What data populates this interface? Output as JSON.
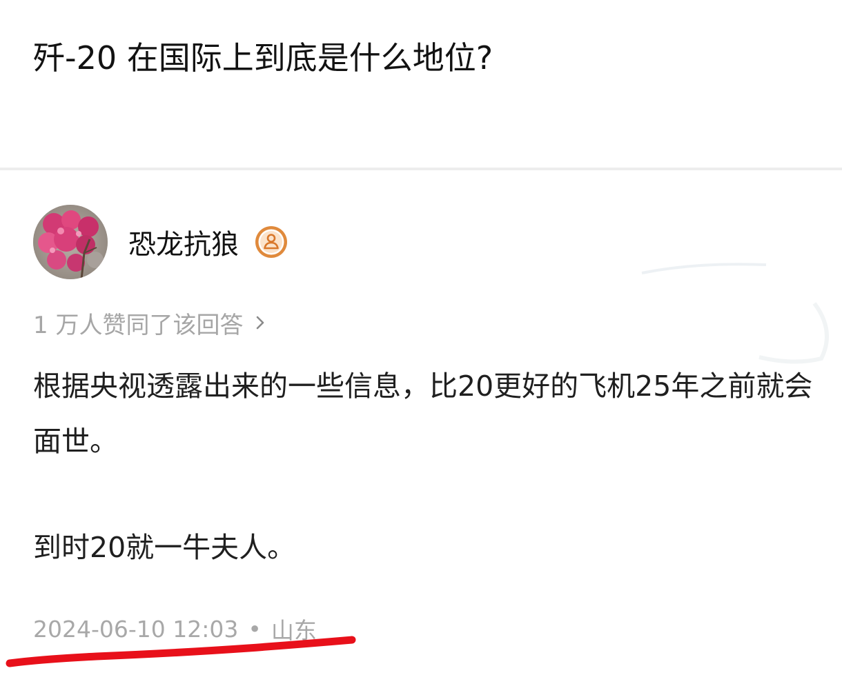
{
  "question": {
    "title": "歼-20 在国际上到底是什么地位?"
  },
  "answer": {
    "author": {
      "name": "恐龙抗狼",
      "badge_icon": "user-badge-icon"
    },
    "vote_summary": "1 万人赞同了该回答",
    "paragraphs": [
      "根据央视透露出来的一些信息，比20更好的飞机25年之前就会面世。",
      "到时20就一牛夫人。"
    ],
    "timestamp": "2024-06-10 12:03",
    "separator": "•",
    "location": "山东"
  },
  "colors": {
    "title_text": "#121212",
    "body_text": "#1f1f1f",
    "muted_text": "#a6a6a6",
    "divider": "#ededed",
    "badge_orange": "#e08a3c",
    "annotation_red": "#e8101a"
  }
}
